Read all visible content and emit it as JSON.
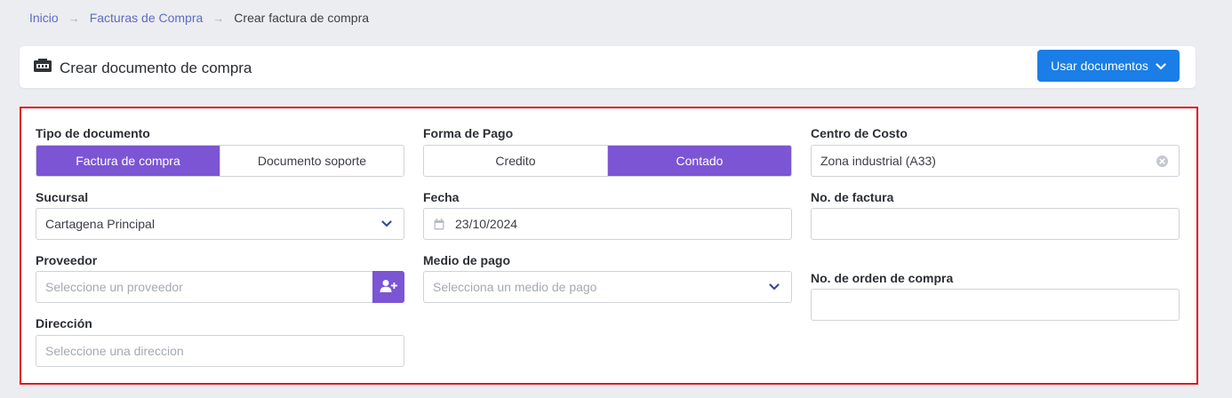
{
  "breadcrumb": {
    "items": [
      "Inicio",
      "Facturas de Compra"
    ],
    "current": "Crear factura de compra"
  },
  "header": {
    "title": "Crear documento de compra",
    "use_docs_label": "Usar documentos"
  },
  "form": {
    "tipo_documento": {
      "label": "Tipo de documento",
      "options": [
        "Factura de compra",
        "Documento soporte"
      ],
      "selected": "Factura de compra"
    },
    "forma_pago": {
      "label": "Forma de Pago",
      "options": [
        "Credito",
        "Contado"
      ],
      "selected": "Contado"
    },
    "centro_costo": {
      "label": "Centro de Costo",
      "value": "Zona industrial (A33)"
    },
    "sucursal": {
      "label": "Sucursal",
      "value": "Cartagena Principal"
    },
    "fecha": {
      "label": "Fecha",
      "value": "23/10/2024"
    },
    "no_factura": {
      "label": "No. de factura",
      "value": ""
    },
    "proveedor": {
      "label": "Proveedor",
      "placeholder": "Seleccione un proveedor"
    },
    "medio_pago": {
      "label": "Medio de pago",
      "placeholder": "Selecciona un medio de pago"
    },
    "no_orden": {
      "label": "No. de orden de compra",
      "value": ""
    },
    "direccion": {
      "label": "Dirección",
      "placeholder": "Seleccione una direccion"
    }
  },
  "colors": {
    "accent_purple": "#7b55d4",
    "primary_blue": "#1a7ee6",
    "highlight_red": "#e0141c"
  }
}
